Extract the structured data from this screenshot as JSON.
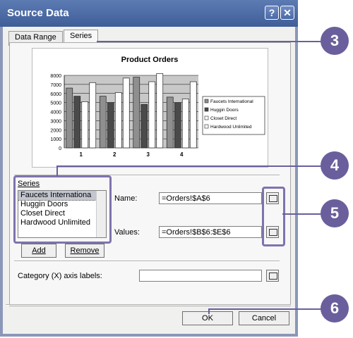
{
  "window": {
    "title": "Source Data",
    "help_glyph": "?",
    "close_glyph": "✕"
  },
  "tabs": [
    {
      "label": "Data Range"
    },
    {
      "label": "Series"
    }
  ],
  "chart_data": {
    "type": "bar",
    "title": "Product Orders",
    "categories": [
      "1",
      "2",
      "3",
      "4"
    ],
    "ylim": [
      0,
      8000
    ],
    "yticks": [
      "0",
      "1000",
      "2000",
      "3000",
      "4000",
      "5000",
      "6000",
      "7000",
      "8000"
    ],
    "series": [
      {
        "name": "Faucets International",
        "color": "#8f8f8f",
        "values": [
          6600,
          5700,
          7800,
          5600
        ]
      },
      {
        "name": "Huggin Doors",
        "color": "#4a4a4a",
        "values": [
          5700,
          5000,
          4800,
          5000
        ]
      },
      {
        "name": "Closet Direct",
        "color": "#ffffff",
        "values": [
          5100,
          6100,
          7300,
          5400
        ]
      },
      {
        "name": "Hardwood Unlimited",
        "color": "#ffffff",
        "values": [
          7200,
          7700,
          8200,
          7300
        ]
      }
    ]
  },
  "series_section": {
    "label": "Series",
    "items": [
      "Faucets Internationa",
      "Huggin Doors",
      "Closet Direct",
      "Hardwood Unlimited"
    ],
    "add_label": "Add",
    "remove_label": "Remove"
  },
  "name_field": {
    "label": "Name:",
    "value": "=Orders!$A$6"
  },
  "values_field": {
    "label": "Values:",
    "value": "=Orders!$B$6:$E$6"
  },
  "category_field": {
    "label": "Category (X) axis labels:",
    "value": ""
  },
  "buttons": {
    "ok": "OK",
    "cancel": "Cancel"
  },
  "callouts": [
    "3",
    "4",
    "5",
    "6"
  ]
}
